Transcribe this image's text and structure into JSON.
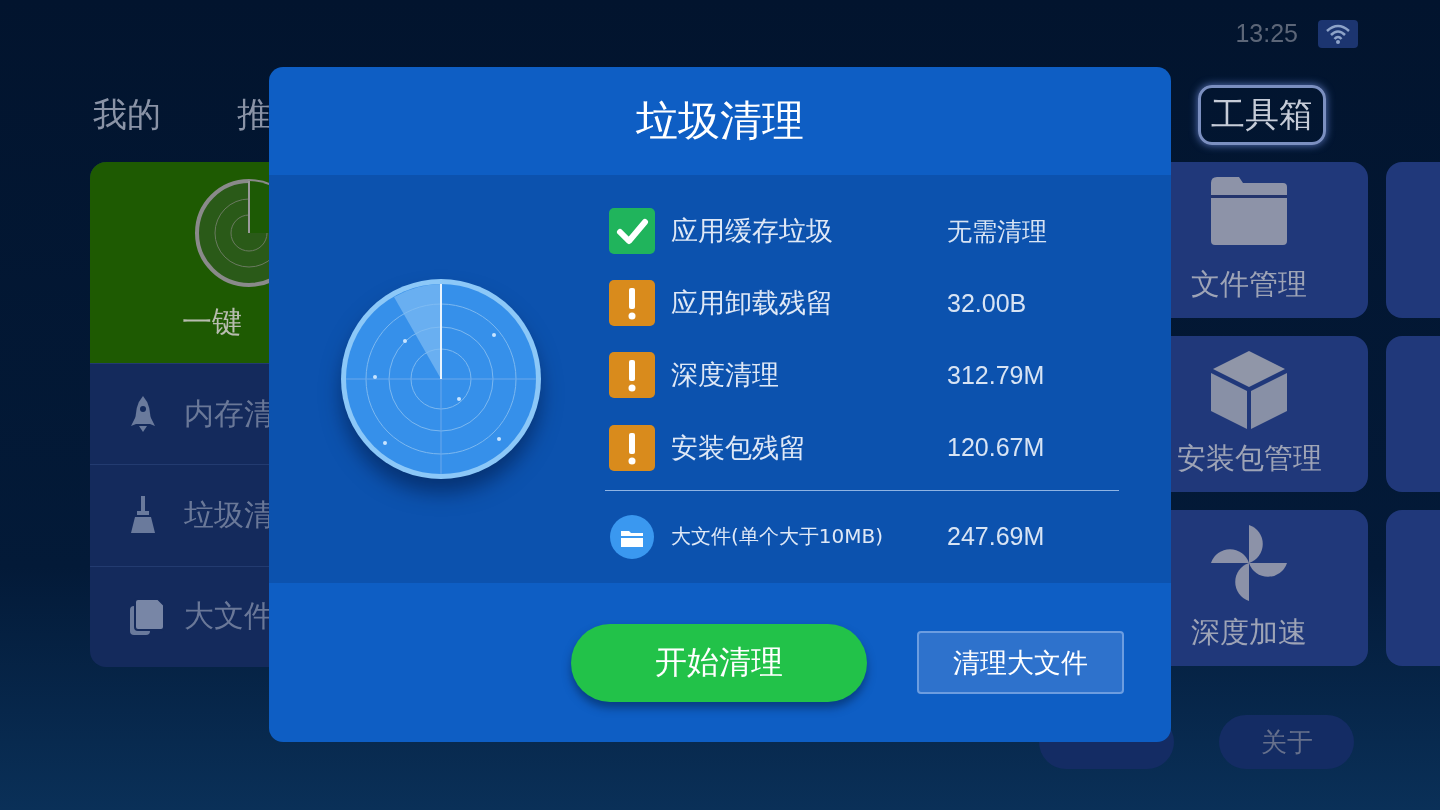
{
  "status_bar": {
    "time": "13:25"
  },
  "tabs": [
    {
      "label": "我的",
      "selected": false
    },
    {
      "label": "推",
      "selected": false
    },
    {
      "label": "工具箱",
      "selected": true
    }
  ],
  "left_panel": {
    "header": "一键",
    "items": [
      {
        "kind": "rocket",
        "label": "内存清"
      },
      {
        "kind": "broom",
        "label": "垃圾清"
      },
      {
        "kind": "files",
        "label": "大文件"
      }
    ]
  },
  "tools": [
    {
      "kind": "folder",
      "label": "文件管理"
    },
    {
      "kind": "box",
      "label": "安装包管理"
    },
    {
      "kind": "fan",
      "label": "深度加速"
    }
  ],
  "bottom_buttons": [
    {
      "kind": "covered"
    },
    {
      "kind": "labeled",
      "label": "关于"
    }
  ],
  "dialog": {
    "title": "垃圾清理",
    "items": [
      {
        "kind": "ok",
        "label": "应用缓存垃圾",
        "value": "无需清理"
      },
      {
        "kind": "warning",
        "label": "应用卸载残留",
        "value": "32.00B"
      },
      {
        "kind": "warning",
        "label": "深度清理",
        "value": "312.79M"
      },
      {
        "kind": "warning",
        "label": "安装包残留",
        "value": "120.67M"
      },
      {
        "kind": "folder",
        "label": "大文件(单个大于10MB)",
        "value": "247.69M"
      }
    ],
    "primary_button": "开始清理",
    "secondary_button": "清理大文件"
  }
}
